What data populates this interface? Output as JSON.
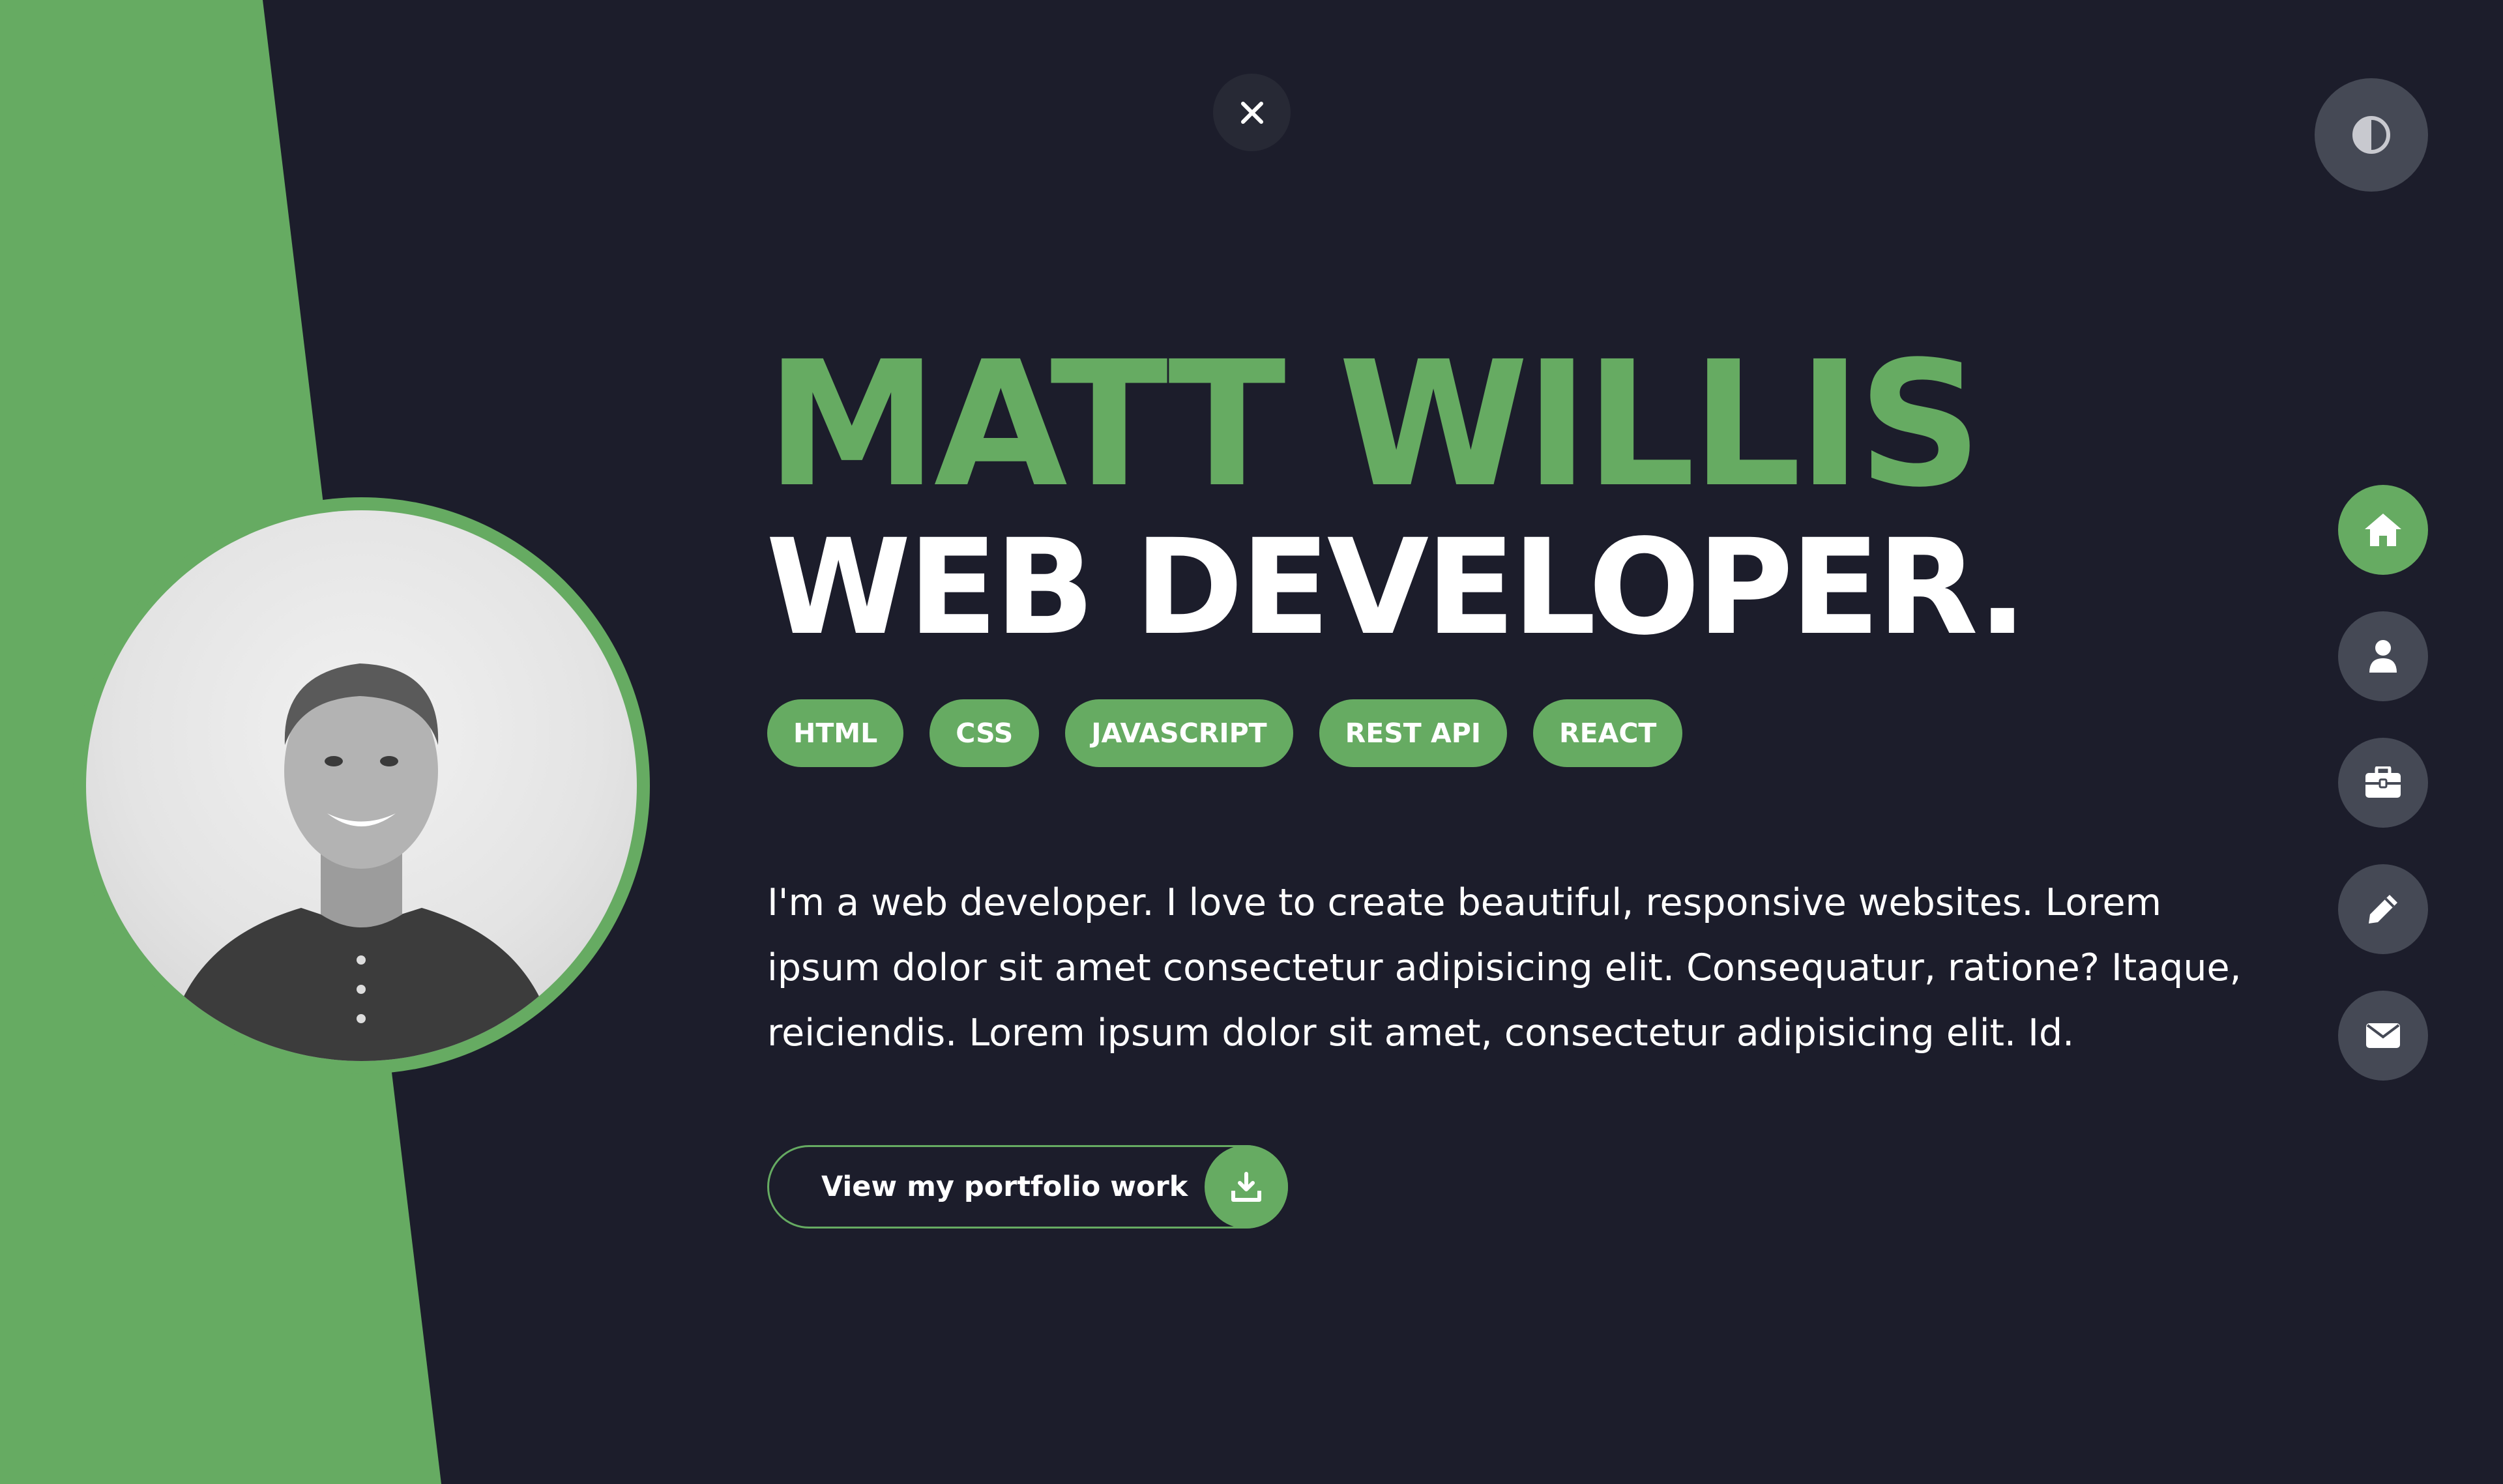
{
  "colors": {
    "background": "#1c1d2b",
    "accent": "#66ab62",
    "button_gray": "#454955",
    "text": "#ffffff"
  },
  "hero": {
    "name": "MATT WILLIS",
    "role": "WEB DEVELOPER.",
    "skills": [
      "HTML",
      "CSS",
      "JAVASCRIPT",
      "REST API",
      "REACT"
    ],
    "bio": "I'm a web developer. I love to create beautiful, responsive websites. Lorem ipsum dolor sit amet consectetur adipisicing elit. Consequatur, ratione? Itaque, reiciendis. Lorem ipsum dolor sit amet, consectetur adipisicing elit. Id.",
    "cta_label": "View my portfolio work"
  },
  "controls": {
    "close_icon": "close-icon",
    "theme_icon": "contrast-icon"
  },
  "nav": {
    "items": [
      {
        "icon": "home-icon",
        "active": true
      },
      {
        "icon": "user-icon",
        "active": false
      },
      {
        "icon": "briefcase-icon",
        "active": false
      },
      {
        "icon": "pencil-icon",
        "active": false
      },
      {
        "icon": "envelope-icon",
        "active": false
      }
    ]
  }
}
